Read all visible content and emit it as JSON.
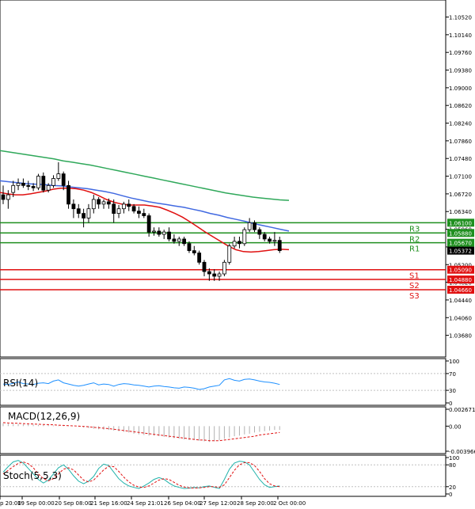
{
  "chart_data": {
    "type": "candlestick",
    "main": {
      "yticks": [
        "1.10520",
        "1.10140",
        "1.09760",
        "1.09380",
        "1.09000",
        "1.08620",
        "1.08240",
        "1.07860",
        "1.07480",
        "1.07100",
        "1.06720",
        "1.06340",
        "1.05960",
        "1.05580",
        "1.05200",
        "1.04820",
        "1.04440",
        "1.04060",
        "1.03680"
      ],
      "ylim": [
        1.0335,
        1.1075
      ],
      "current_price": "1.05372",
      "levels": [
        {
          "name": "R3",
          "value": 1.061,
          "label": "1.06100",
          "color": "#1f8f1f"
        },
        {
          "name": "R2",
          "value": 1.0588,
          "label": "1.05880",
          "color": "#1f8f1f"
        },
        {
          "name": "R1",
          "value": 1.0567,
          "label": "1.05670",
          "color": "#1f8f1f"
        },
        {
          "name": "S1",
          "value": 1.0509,
          "label": "1.05090",
          "color": "#e01010"
        },
        {
          "name": "S2",
          "value": 1.0488,
          "label": "1.04880",
          "color": "#e01010"
        },
        {
          "name": "S3",
          "value": 1.0466,
          "label": "1.04660",
          "color": "#e01010"
        }
      ],
      "candles": [
        [
          1.067,
          1.069,
          1.065,
          1.066
        ],
        [
          1.066,
          1.068,
          1.064,
          1.067
        ],
        [
          1.0675,
          1.07,
          1.0665,
          1.069
        ],
        [
          1.069,
          1.0705,
          1.068,
          1.0695
        ],
        [
          1.0695,
          1.0705,
          1.0685,
          1.069
        ],
        [
          1.069,
          1.07,
          1.068,
          1.0688
        ],
        [
          1.0688,
          1.0695,
          1.0678,
          1.0685
        ],
        [
          1.0685,
          1.0715,
          1.068,
          1.071
        ],
        [
          1.071,
          1.0718,
          1.0675,
          1.068
        ],
        [
          1.068,
          1.0695,
          1.0675,
          1.069
        ],
        [
          1.069,
          1.0712,
          1.0685,
          1.0705
        ],
        [
          1.0705,
          1.074,
          1.07,
          1.0715
        ],
        [
          1.0715,
          1.072,
          1.068,
          1.069
        ],
        [
          1.069,
          1.07,
          1.064,
          1.065
        ],
        [
          1.065,
          1.066,
          1.062,
          1.064
        ],
        [
          1.064,
          1.065,
          1.062,
          1.063
        ],
        [
          1.063,
          1.064,
          1.06,
          1.062
        ],
        [
          1.062,
          1.065,
          1.061,
          1.064
        ],
        [
          1.064,
          1.067,
          1.063,
          1.066
        ],
        [
          1.066,
          1.0665,
          1.064,
          1.065
        ],
        [
          1.065,
          1.066,
          1.064,
          1.0655
        ],
        [
          1.0655,
          1.0662,
          1.064,
          1.065
        ],
        [
          1.065,
          1.066,
          1.061,
          1.063
        ],
        [
          1.063,
          1.0648,
          1.062,
          1.064
        ],
        [
          1.064,
          1.0655,
          1.063,
          1.065
        ],
        [
          1.065,
          1.066,
          1.0635,
          1.0645
        ],
        [
          1.0645,
          1.065,
          1.063,
          1.0635
        ],
        [
          1.0635,
          1.0645,
          1.062,
          1.063
        ],
        [
          1.063,
          1.064,
          1.062,
          1.0625
        ],
        [
          1.0625,
          1.063,
          1.058,
          1.059
        ],
        [
          1.059,
          1.06,
          1.0582,
          1.0592
        ],
        [
          1.0592,
          1.06,
          1.058,
          1.0585
        ],
        [
          1.0585,
          1.0595,
          1.0575,
          1.059
        ],
        [
          1.059,
          1.06,
          1.057,
          1.0575
        ],
        [
          1.0575,
          1.0585,
          1.0565,
          1.057
        ],
        [
          1.057,
          1.058,
          1.056,
          1.0575
        ],
        [
          1.0575,
          1.058,
          1.056,
          1.0565
        ],
        [
          1.0565,
          1.057,
          1.0545,
          1.055
        ],
        [
          1.055,
          1.056,
          1.054,
          1.0545
        ],
        [
          1.0545,
          1.055,
          1.052,
          1.0525
        ],
        [
          1.0525,
          1.053,
          1.0495,
          1.0505
        ],
        [
          1.0505,
          1.0512,
          1.0485,
          1.05
        ],
        [
          1.05,
          1.051,
          1.0485,
          1.0495
        ],
        [
          1.0495,
          1.0505,
          1.0485,
          1.05
        ],
        [
          1.05,
          1.053,
          1.0495,
          1.0525
        ],
        [
          1.0525,
          1.0565,
          1.052,
          1.056
        ],
        [
          1.056,
          1.058,
          1.0555,
          1.057
        ],
        [
          1.057,
          1.058,
          1.0555,
          1.0565
        ],
        [
          1.0565,
          1.06,
          1.056,
          1.0595
        ],
        [
          1.0595,
          1.062,
          1.059,
          1.061
        ],
        [
          1.061,
          1.0615,
          1.059,
          1.0595
        ],
        [
          1.0595,
          1.06,
          1.0575,
          1.0585
        ],
        [
          1.0585,
          1.059,
          1.057,
          1.0575
        ],
        [
          1.0575,
          1.058,
          1.0565,
          1.057
        ],
        [
          1.057,
          1.059,
          1.056,
          1.0572
        ],
        [
          1.0572,
          1.058,
          1.0545,
          1.055
        ]
      ],
      "ma_fast": [
        1.0675,
        1.0672,
        1.067,
        1.067,
        1.0672,
        1.0675,
        1.0678,
        1.0682,
        1.0684,
        1.0684,
        1.0683,
        1.068,
        1.0675,
        1.0668,
        1.066,
        1.0654,
        1.065,
        1.0648,
        1.0648,
        1.0648,
        1.0646,
        1.0643,
        1.0637,
        1.063,
        1.0622,
        1.0612,
        1.0601,
        1.059,
        1.058,
        1.057,
        1.056,
        1.0552,
        1.0548,
        1.0547,
        1.0548,
        1.055,
        1.0552,
        1.0553,
        1.0552
      ],
      "ma_mid": [
        1.07,
        1.0698,
        1.0696,
        1.0694,
        1.0693,
        1.0692,
        1.069,
        1.0689,
        1.0687,
        1.0685,
        1.0683,
        1.068,
        1.0677,
        1.0673,
        1.0668,
        1.0663,
        1.0659,
        1.0655,
        1.0652,
        1.0649,
        1.0646,
        1.0643,
        1.0639,
        1.0635,
        1.063,
        1.0626,
        1.0621,
        1.0617,
        1.0613,
        1.0608,
        1.0604,
        1.06,
        1.0596,
        1.0592
      ],
      "ma_slow": [
        1.0765,
        1.0762,
        1.0759,
        1.0756,
        1.0753,
        1.075,
        1.0747,
        1.0743,
        1.074,
        1.0737,
        1.0734,
        1.073,
        1.0726,
        1.0722,
        1.0718,
        1.0714,
        1.071,
        1.0706,
        1.0702,
        1.0698,
        1.0694,
        1.069,
        1.0686,
        1.0682,
        1.0678,
        1.0674,
        1.0671,
        1.0668,
        1.0665,
        1.0663,
        1.0661,
        1.0659,
        1.0658
      ]
    },
    "rsi": {
      "title": "RSI(14)",
      "yticks": [
        "100",
        "70",
        "30",
        "0"
      ],
      "values": [
        45,
        44,
        47,
        50,
        46,
        45,
        44,
        47,
        48,
        46,
        52,
        55,
        48,
        45,
        42,
        40,
        42,
        45,
        48,
        43,
        45,
        44,
        40,
        44,
        46,
        45,
        43,
        42,
        40,
        38,
        40,
        41,
        39,
        38,
        36,
        35,
        38,
        37,
        35,
        32,
        34,
        38,
        40,
        42,
        55,
        58,
        54,
        52,
        56,
        57,
        55,
        52,
        50,
        49,
        47,
        44
      ]
    },
    "macd": {
      "title": "MACD(12,26,9)",
      "yticks": [
        "0.002671",
        "0.00",
        "-0.003966"
      ],
      "histogram": [
        0.00045,
        0.0004,
        0.00038,
        0.00035,
        0.0003,
        0.00028,
        0.00025,
        0.0002,
        0.00018,
        0.00015,
        0.0001,
        8e-05,
        5e-05,
        3e-05,
        0.0,
        -0.0001,
        -0.0002,
        -0.0003,
        -0.0004,
        -0.0005,
        -0.00055,
        -0.0006,
        -0.0007,
        -0.0008,
        -0.0009,
        -0.001,
        -0.0012,
        -0.0013,
        -0.0014,
        -0.0015,
        -0.0015,
        -0.0016,
        -0.0017,
        -0.0018,
        -0.0019,
        -0.002,
        -0.0021,
        -0.0022,
        -0.0022,
        -0.0023,
        -0.0024,
        -0.0025,
        -0.0024,
        -0.0022,
        -0.002,
        -0.0018,
        -0.0016,
        -0.0015,
        -0.0013,
        -0.0012,
        -0.001,
        -0.0009,
        -0.0008,
        -0.0007,
        -0.0006,
        -0.0006
      ],
      "signal": [
        0.00055,
        0.0005,
        0.00048,
        0.00045,
        0.0004,
        0.00037,
        0.00034,
        0.0003,
        0.00027,
        0.00024,
        0.0002,
        0.00016,
        0.00012,
        8e-05,
        4e-05,
        0.0,
        -5e-05,
        -0.0001,
        -0.00018,
        -0.00025,
        -0.00032,
        -0.0004,
        -0.0005,
        -0.0006,
        -0.0007,
        -0.0008,
        -0.0009,
        -0.001,
        -0.0011,
        -0.0012,
        -0.0013,
        -0.0014,
        -0.0015,
        -0.0016,
        -0.0017,
        -0.0018,
        -0.0019,
        -0.002,
        -0.0021,
        -0.0022,
        -0.0022,
        -0.0023,
        -0.0023,
        -0.0023,
        -0.0022,
        -0.0021,
        -0.002,
        -0.0019,
        -0.0018,
        -0.0017,
        -0.0016,
        -0.0014,
        -0.0013,
        -0.0012,
        -0.0011,
        -0.001
      ]
    },
    "stoch": {
      "title": "Stoch(5,5,3)",
      "yticks": [
        "100",
        "80",
        "20",
        "0"
      ],
      "k": [
        60,
        75,
        88,
        92,
        85,
        70,
        55,
        40,
        30,
        38,
        55,
        72,
        80,
        68,
        50,
        35,
        28,
        35,
        48,
        70,
        82,
        78,
        60,
        42,
        30,
        22,
        18,
        15,
        22,
        30,
        40,
        45,
        40,
        30,
        22,
        18,
        15,
        16,
        18,
        17,
        20,
        22,
        18,
        15,
        40,
        68,
        85,
        90,
        88,
        80,
        60,
        40,
        25,
        18,
        20,
        22
      ],
      "d": [
        55,
        65,
        75,
        84,
        88,
        83,
        72,
        55,
        42,
        36,
        42,
        55,
        68,
        72,
        66,
        52,
        38,
        33,
        38,
        52,
        66,
        76,
        75,
        62,
        46,
        33,
        24,
        19,
        18,
        22,
        30,
        38,
        42,
        40,
        32,
        24,
        19,
        17,
        16,
        17,
        18,
        20,
        20,
        18,
        25,
        45,
        65,
        80,
        86,
        86,
        78,
        62,
        42,
        28,
        22,
        20
      ]
    },
    "xticks": [
      "p 20:00",
      "19 Sep 00:00",
      "20 Sep 08:00",
      "21 Sep 16:00",
      "24 Sep 21:01",
      "26 Sep 04:00",
      "27 Sep 12:00",
      "28 Sep 20:00",
      "2 Oct 00:00"
    ]
  }
}
